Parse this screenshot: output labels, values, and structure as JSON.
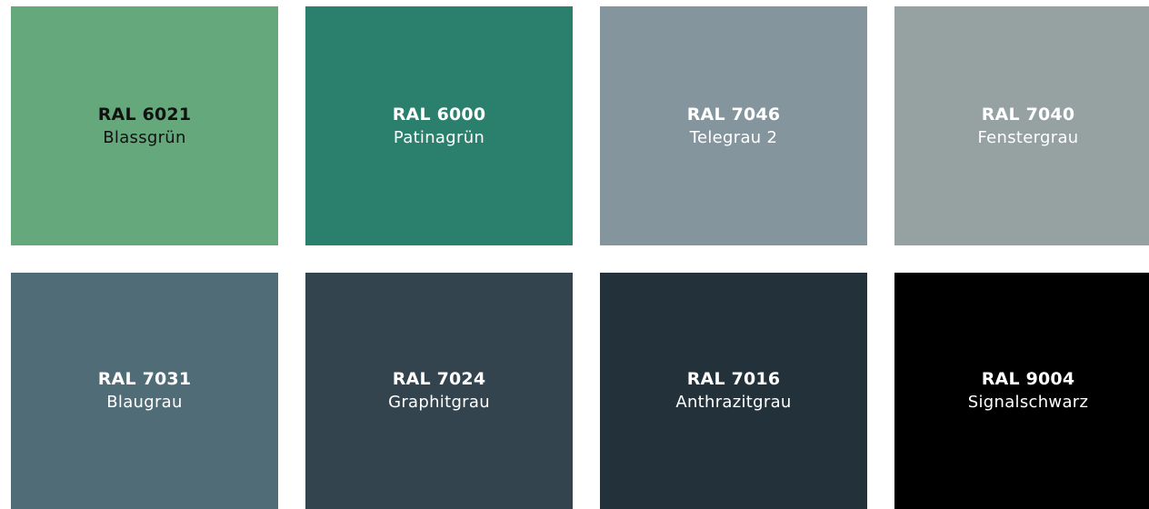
{
  "swatches": [
    {
      "code": "RAL 6021",
      "name": "Blassgrün",
      "color": "#64a87b",
      "text_color": "#111111"
    },
    {
      "code": "RAL 6000",
      "name": "Patinagrün",
      "color": "#2b7f6d",
      "text_color": "#ffffff"
    },
    {
      "code": "RAL 7046",
      "name": "Telegrau 2",
      "color": "#85959e",
      "text_color": "#ffffff"
    },
    {
      "code": "RAL 7040",
      "name": "Fenstergrau",
      "color": "#96a1a1",
      "text_color": "#ffffff"
    },
    {
      "code": "RAL 7031",
      "name": "Blaugrau",
      "color": "#506c76",
      "text_color": "#ffffff"
    },
    {
      "code": "RAL 7024",
      "name": "Graphitgrau",
      "color": "#34444f",
      "text_color": "#ffffff"
    },
    {
      "code": "RAL 7016",
      "name": "Anthrazitgrau",
      "color": "#23323a",
      "text_color": "#ffffff"
    },
    {
      "code": "RAL 9004",
      "name": "Signalschwarz",
      "color": "#000000",
      "text_color": "#ffffff"
    }
  ]
}
